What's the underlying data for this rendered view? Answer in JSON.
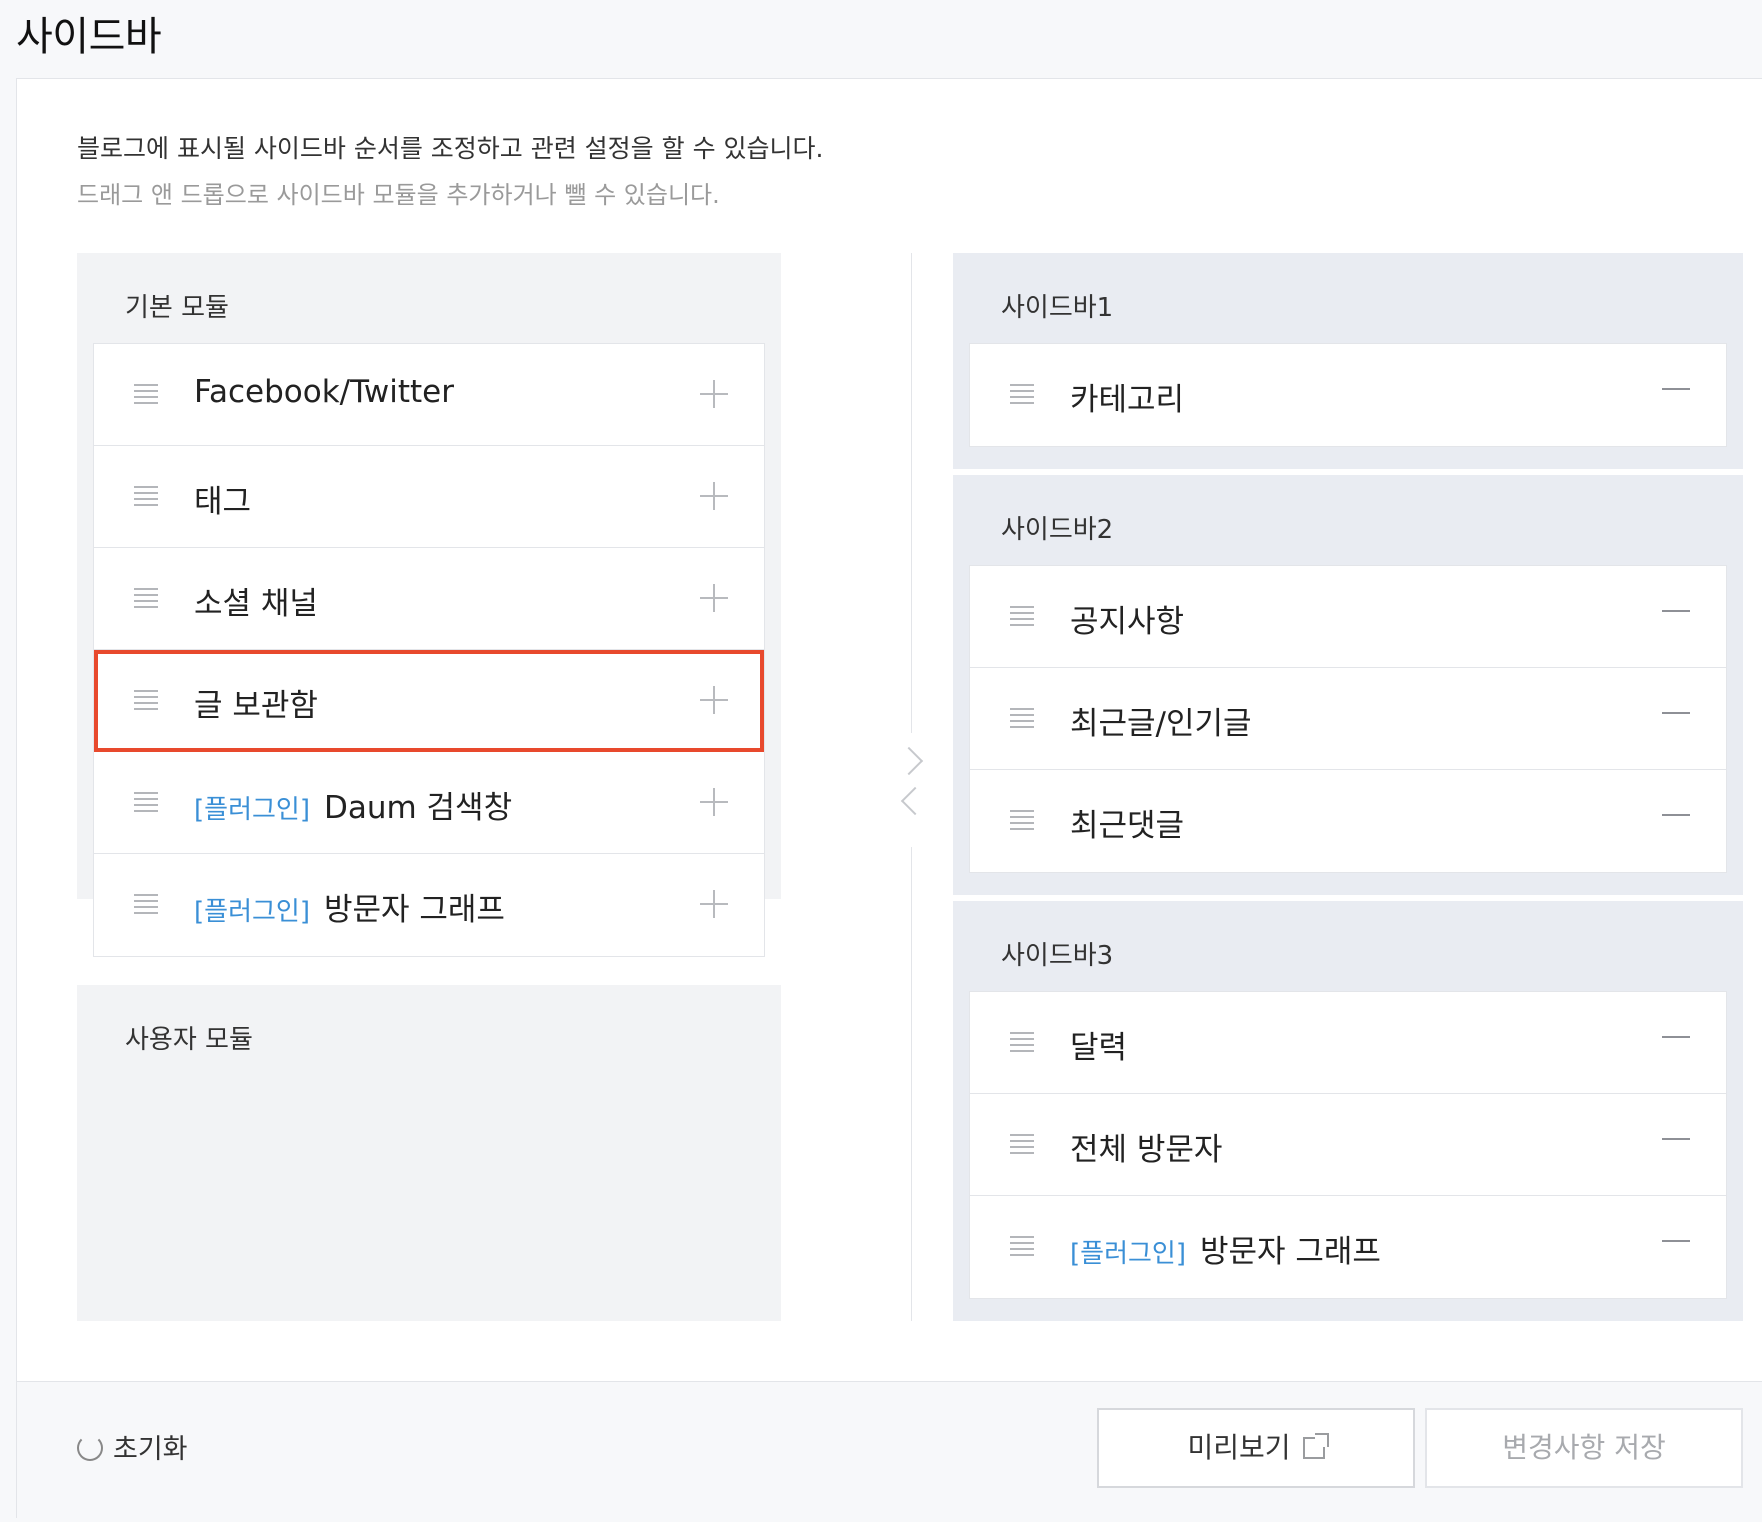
{
  "page": {
    "title": "사이드바"
  },
  "description": {
    "line1": "블로그에 표시될 사이드바 순서를 조정하고 관련 설정을 할 수 있습니다.",
    "line2": "드래그 앤 드롭으로 사이드바 모듈을 추가하거나 뺄 수 있습니다."
  },
  "basic_modules": {
    "title": "기본 모듈",
    "items": [
      {
        "label": "Facebook/Twitter",
        "plugin_tag": ""
      },
      {
        "label": "태그",
        "plugin_tag": ""
      },
      {
        "label": "소셜 채널",
        "plugin_tag": ""
      },
      {
        "label": "글 보관함",
        "plugin_tag": "",
        "highlighted": true
      },
      {
        "label": "Daum 검색창",
        "plugin_tag": "[플러그인]"
      },
      {
        "label": "방문자 그래프",
        "plugin_tag": "[플러그인]"
      }
    ]
  },
  "user_modules": {
    "title": "사용자 모듈"
  },
  "sidebars": [
    {
      "title": "사이드바1",
      "items": [
        {
          "label": "카테고리",
          "plugin_tag": ""
        }
      ]
    },
    {
      "title": "사이드바2",
      "items": [
        {
          "label": "공지사항",
          "plugin_tag": ""
        },
        {
          "label": "최근글/인기글",
          "plugin_tag": ""
        },
        {
          "label": "최근댓글",
          "plugin_tag": ""
        }
      ]
    },
    {
      "title": "사이드바3",
      "items": [
        {
          "label": "달력",
          "plugin_tag": ""
        },
        {
          "label": "전체 방문자",
          "plugin_tag": ""
        },
        {
          "label": "방문자 그래프",
          "plugin_tag": "[플러그인]"
        }
      ]
    }
  ],
  "footer": {
    "reset_label": "초기화",
    "preview_label": "미리보기",
    "save_label": "변경사항 저장"
  },
  "colors": {
    "highlight": "#e8492d",
    "plugin_tag": "#3a8fd6"
  }
}
